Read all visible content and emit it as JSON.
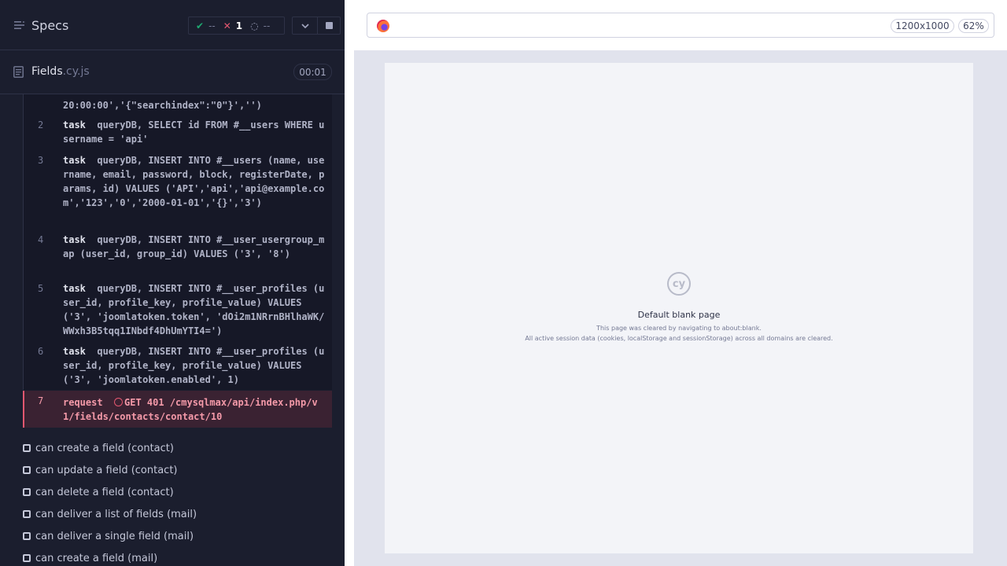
{
  "header": {
    "title": "Specs",
    "passed": "--",
    "failed": "1",
    "pending": "--"
  },
  "file": {
    "name": "Fields",
    "ext": ".cy.js",
    "duration": "00:01"
  },
  "commands": [
    {
      "idx": "",
      "kw": "",
      "text": "20:00:00','{\"searchindex\":\"0\"}','')"
    },
    {
      "idx": "2",
      "kw": "task",
      "text": "queryDB, SELECT id FROM #__users WHERE username = 'api'"
    },
    {
      "idx": "3",
      "kw": "task",
      "text": "queryDB, INSERT INTO #__users (name, username, email, password, block, registerDate, params, id) VALUES ('API','api','api@example.com','123','0','2000-01-01','{}','3')"
    },
    {
      "idx": "4",
      "kw": "task",
      "text": "queryDB, INSERT INTO #__user_usergroup_map (user_id, group_id) VALUES ('3', '8')"
    },
    {
      "idx": "5",
      "kw": "task",
      "text": "queryDB, INSERT INTO #__user_profiles (user_id, profile_key, profile_value) VALUES ('3', 'joomlatoken.token', 'dOi2m1NRrnBHlhaWK/WWxh3B5tqq1INbdf4DhUmYTI4=')"
    },
    {
      "idx": "6",
      "kw": "task",
      "text": "queryDB, INSERT INTO #__user_profiles (user_id, profile_key, profile_value) VALUES ('3', 'joomlatoken.enabled', 1)"
    },
    {
      "idx": "7",
      "kw": "request",
      "text": "GET 401 /cmysqlmax/api/index.php/v1/fields/contacts/contact/10"
    }
  ],
  "tests": [
    "can create a field (contact)",
    "can update a field (contact)",
    "can delete a field (contact)",
    "can deliver a list of fields (mail)",
    "can deliver a single field (mail)",
    "can create a field (mail)"
  ],
  "aut": {
    "viewport": "1200x1000",
    "zoom": "62%",
    "logo_text": "cy",
    "blank_title": "Default blank page",
    "blank_line1": "This page was cleared by navigating to about:blank.",
    "blank_line2": "All active session data (cookies, localStorage and sessionStorage) across all domains are cleared."
  },
  "colors": {
    "pass": "#1fa971",
    "fail": "#e45770",
    "bg": "#1b1e2e"
  },
  "icons": [
    "specs-list-icon",
    "check-icon",
    "x-icon",
    "spinner-icon",
    "chevron-down-icon",
    "stop-icon",
    "document-icon",
    "firefox-icon",
    "cypress-logo"
  ]
}
